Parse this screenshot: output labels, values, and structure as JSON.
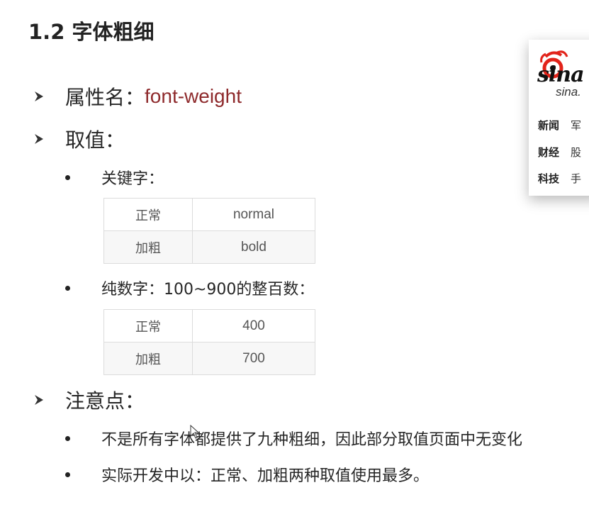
{
  "title": "1.2 字体粗细",
  "property": {
    "label": "属性名：",
    "value": "font-weight"
  },
  "values_heading": "取值：",
  "keyword": {
    "label": "关键字：",
    "rows": [
      {
        "name": "正常",
        "value": "normal"
      },
      {
        "name": "加粗",
        "value": "bold"
      }
    ]
  },
  "numeric": {
    "label": "纯数字：100~900的整百数：",
    "rows": [
      {
        "name": "正常",
        "value": "400"
      },
      {
        "name": "加粗",
        "value": "700"
      }
    ]
  },
  "notes": {
    "heading": "注意点：",
    "items": [
      "不是所有字体都提供了九种粗细，因此部分取值页面中无变化",
      "实际开发中以：正常、加粗两种取值使用最多。"
    ]
  },
  "sina_card": {
    "logo_text": "sina",
    "logo_sub": "sina.",
    "rows": [
      {
        "category": "新闻",
        "sub": "军"
      },
      {
        "category": "财经",
        "sub": "股"
      },
      {
        "category": "科技",
        "sub": "手"
      }
    ]
  },
  "colors": {
    "accent": "#8e2a2c",
    "text": "#262626",
    "table_text": "#555555",
    "table_border": "#dcdcdc",
    "sina_red": "#e2231a"
  }
}
